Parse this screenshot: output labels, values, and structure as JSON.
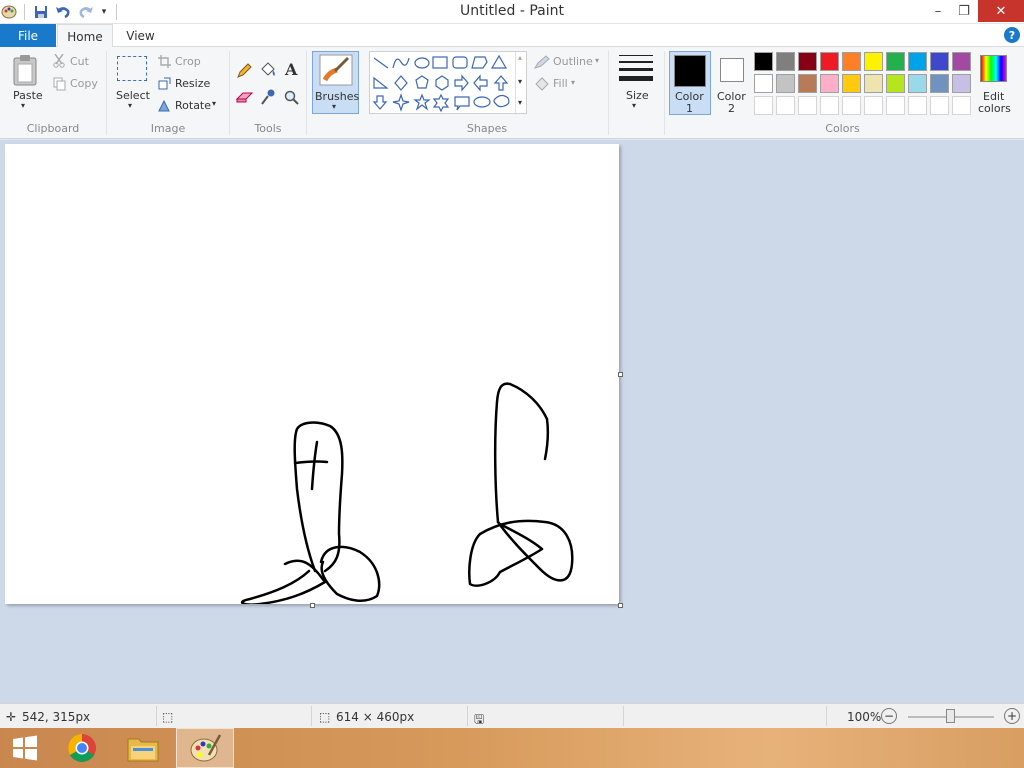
{
  "window": {
    "title": "Untitled - Paint",
    "minimize": "–",
    "maximize": "❐",
    "close": "✕"
  },
  "tabs": {
    "file": "File",
    "home": "Home",
    "view": "View",
    "help": "?"
  },
  "clipboard": {
    "paste": "Paste",
    "cut": "Cut",
    "copy": "Copy",
    "group": "Clipboard"
  },
  "image": {
    "select": "Select",
    "crop": "Crop",
    "resize": "Resize",
    "rotate": "Rotate",
    "group": "Image"
  },
  "tools": {
    "group": "Tools",
    "text_glyph": "A"
  },
  "brushes": {
    "label": "Brushes"
  },
  "shapes": {
    "outline": "Outline",
    "fill": "Fill",
    "group": "Shapes"
  },
  "size": {
    "label": "Size"
  },
  "colors": {
    "color1": "Color\n1",
    "color1_a": "Color",
    "color1_b": "1",
    "color2_a": "Color",
    "color2_b": "2",
    "edit_a": "Edit",
    "edit_b": "colors",
    "group": "Colors",
    "color1_value": "#000000",
    "color2_value": "#ffffff",
    "palette_row1": [
      "#000000",
      "#7f7f7f",
      "#880015",
      "#ed1c24",
      "#ff7f27",
      "#fff200",
      "#22b14c",
      "#00a2e8",
      "#3f48cc",
      "#a349a4"
    ],
    "palette_row2": [
      "#ffffff",
      "#c3c3c3",
      "#b97a57",
      "#ffaec9",
      "#ffc90e",
      "#efe4b0",
      "#b5e61d",
      "#99d9ea",
      "#7092be",
      "#c8bfe7"
    ]
  },
  "status": {
    "cursor_pos": "542, 315px",
    "canvas_size": "614 × 460px",
    "zoom": "100%"
  },
  "taskbar": {
    "apps": [
      "start",
      "chrome",
      "file-explorer",
      "paint"
    ]
  }
}
